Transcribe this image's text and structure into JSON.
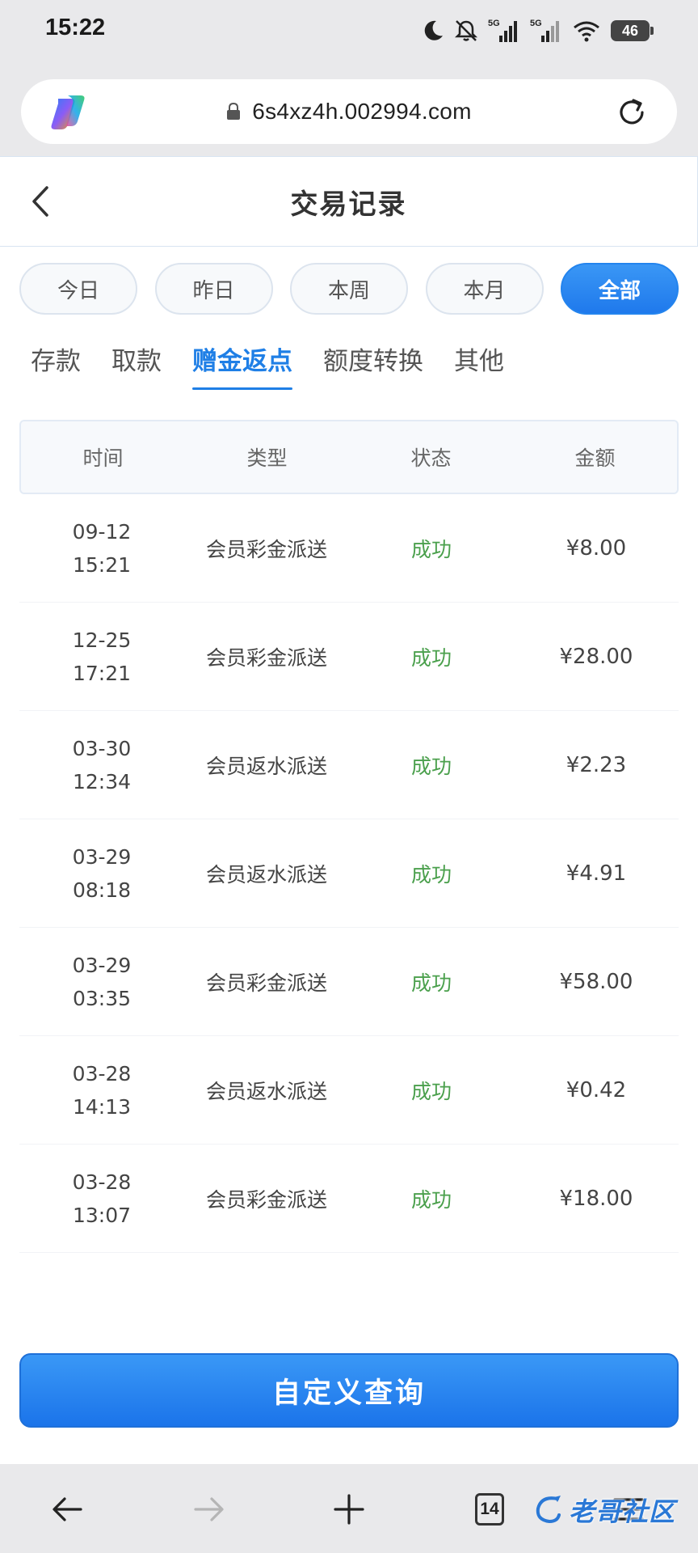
{
  "status_bar": {
    "time": "15:22",
    "battery": "46"
  },
  "browser": {
    "url": "6s4xz4h.002994.com",
    "tab_count": "14"
  },
  "header": {
    "title": "交易记录"
  },
  "date_filters": [
    {
      "label": "今日",
      "active": false
    },
    {
      "label": "昨日",
      "active": false
    },
    {
      "label": "本周",
      "active": false
    },
    {
      "label": "本月",
      "active": false
    },
    {
      "label": "全部",
      "active": true
    }
  ],
  "tabs": [
    {
      "label": "存款",
      "active": false
    },
    {
      "label": "取款",
      "active": false
    },
    {
      "label": "赠金返点",
      "active": true
    },
    {
      "label": "额度转换",
      "active": false
    },
    {
      "label": "其他",
      "active": false
    }
  ],
  "table": {
    "columns": [
      "时间",
      "类型",
      "状态",
      "金额"
    ],
    "rows": [
      {
        "date": "09-12",
        "time": "15:21",
        "type": "会员彩金派送",
        "status": "成功",
        "amount": "¥8.00"
      },
      {
        "date": "12-25",
        "time": "17:21",
        "type": "会员彩金派送",
        "status": "成功",
        "amount": "¥28.00"
      },
      {
        "date": "03-30",
        "time": "12:34",
        "type": "会员返水派送",
        "status": "成功",
        "amount": "¥2.23"
      },
      {
        "date": "03-29",
        "time": "08:18",
        "type": "会员返水派送",
        "status": "成功",
        "amount": "¥4.91"
      },
      {
        "date": "03-29",
        "time": "03:35",
        "type": "会员彩金派送",
        "status": "成功",
        "amount": "¥58.00"
      },
      {
        "date": "03-28",
        "time": "14:13",
        "type": "会员返水派送",
        "status": "成功",
        "amount": "¥0.42"
      },
      {
        "date": "03-28",
        "time": "13:07",
        "type": "会员彩金派送",
        "status": "成功",
        "amount": "¥18.00"
      }
    ]
  },
  "query_button": "自定义查询",
  "watermark": "老哥社区",
  "colors": {
    "accent": "#1f7fe6",
    "success": "#4ba04d",
    "chrome_bg": "#e9e9eb"
  }
}
